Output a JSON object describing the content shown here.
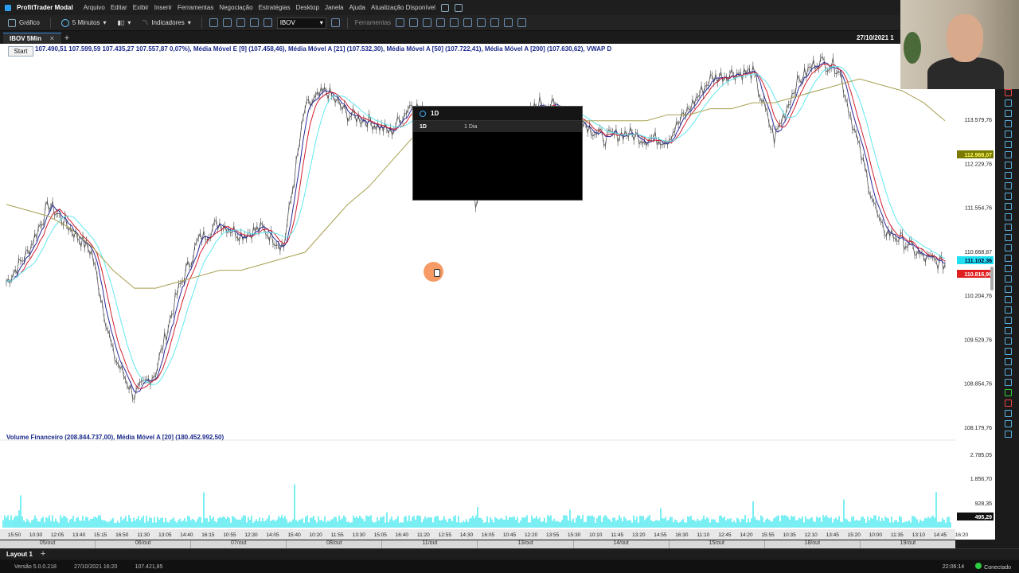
{
  "menubar": {
    "app_title": "ProfitTrader Modal",
    "items": [
      "Arquivo",
      "Editar",
      "Exibir",
      "Inserir",
      "Ferramentas",
      "Negociação",
      "Estratégias",
      "Desktop",
      "Janela",
      "Ajuda",
      "Atualização Disponível"
    ]
  },
  "toolbar": {
    "chart_label": "Gráfico",
    "interval": "5 Minutos",
    "indicators": "Indicadores",
    "asset": "IBOV",
    "tools_label": "Ferramentas"
  },
  "tabs": {
    "active": "IBOV 5Min"
  },
  "datestamp": "27/10/2021 1",
  "start_label": "Start",
  "legend": "107.490,51  107.599,59  107.435,27  107.557,87  0,07%), Média Móvel E [9] (107.458,46), Média Móvel A [21] (107.532,30), Média Móvel A [50] (107.722,41), Média Móvel A [200] (107.630,62), VWAP D",
  "volume_legend": "Volume Financeiro (208.844.737,00), Média Móvel A [20] (180.452.992,50)",
  "search": {
    "query": "1D",
    "result_code": "1D",
    "result_desc": "1 Dia"
  },
  "price_axis": [
    "113.579,76",
    "112.229,76",
    "111.554,76",
    "110.668,87",
    "110.204,76",
    "109.529,76",
    "108.854,76",
    "108.179,76"
  ],
  "price_badges": [
    {
      "label": "112.968,07",
      "color": "#7a7a00",
      "text_color": "#ffff66"
    },
    {
      "label": "111.102,36",
      "color": "#20e0f0",
      "text_color": "#003"
    },
    {
      "label": "110.816,96",
      "color": "#e02020",
      "text_color": "#fff"
    }
  ],
  "volume_axis": [
    "2.785,05",
    "1.856,70",
    "928,35"
  ],
  "volume_badge": "495,29",
  "time_axis": [
    "15:50",
    "10:30",
    "12:05",
    "13:40",
    "15:15",
    "16:50",
    "11:30",
    "13:05",
    "14:40",
    "16:15",
    "10:55",
    "12:30",
    "14:05",
    "15:40",
    "10:20",
    "11:55",
    "13:30",
    "15:05",
    "16:40",
    "11:20",
    "12:55",
    "14:30",
    "16:05",
    "10:45",
    "12:20",
    "13:55",
    "15:30",
    "10:10",
    "11:45",
    "13:20",
    "14:55",
    "16:30",
    "11:10",
    "12:45",
    "14:20",
    "15:55",
    "10:35",
    "12:10",
    "13:45",
    "15:20",
    "10:00",
    "11:35",
    "13:10",
    "14:45",
    "16:20"
  ],
  "date_axis": [
    "05/out",
    "06/out",
    "07/out",
    "08/out",
    "11/out",
    "13/out",
    "14/out",
    "15/out",
    "18/out",
    "19/out"
  ],
  "bottom": {
    "layout_tab": "Layout 1"
  },
  "status": {
    "version": "Versão 5.0.0.218",
    "date": "27/10/2021 16:20",
    "price": "107.421,85",
    "clock": "22:06:14",
    "connection": "Conectado"
  },
  "chart_data": {
    "type": "line",
    "series": [],
    "x": [
      "15:50",
      "10:30",
      "12:05",
      "13:40",
      "15:15",
      "16:50",
      "11:30",
      "13:05",
      "14:40",
      "16:15",
      "10:55",
      "12:30",
      "14:05",
      "15:40",
      "10:20",
      "11:55",
      "13:30",
      "15:05",
      "16:40",
      "11:20",
      "12:55",
      "14:30",
      "16:05",
      "10:45",
      "12:20",
      "13:55",
      "15:30",
      "10:10",
      "11:45",
      "13:20",
      "14:55",
      "16:30",
      "11:10",
      "12:45",
      "14:20",
      "15:55",
      "10:35",
      "12:10",
      "13:45",
      "15:20",
      "10:00",
      "11:35",
      "13:10",
      "14:45",
      "16:20"
    ],
    "ylim": [
      108000,
      114200
    ],
    "price": [
      110400,
      110900,
      111700,
      111300,
      110900,
      109200,
      108500,
      108900,
      110200,
      111100,
      111400,
      111200,
      111300,
      111000,
      113300,
      113600,
      113200,
      113100,
      112900,
      113400,
      113100,
      113000,
      111700,
      113100,
      113000,
      113400,
      113300,
      113100,
      112800,
      112900,
      112800,
      112800,
      113300,
      113800,
      113900,
      113900,
      112800,
      113700,
      114100,
      114000,
      112600,
      111300,
      111100,
      110800,
      110700
    ],
    "sma200": [
      111700,
      111600,
      111500,
      111300,
      111000,
      110600,
      110300,
      110300,
      110400,
      110500,
      110600,
      110600,
      110700,
      110800,
      110900,
      111300,
      111700,
      112000,
      112400,
      112800,
      112900,
      113000,
      113000,
      113000,
      113000,
      113000,
      113000,
      113100,
      113100,
      113100,
      113100,
      113200,
      113200,
      113300,
      113300,
      113400,
      113400,
      113500,
      113600,
      113700,
      113800,
      113700,
      113600,
      113400,
      113100
    ]
  }
}
